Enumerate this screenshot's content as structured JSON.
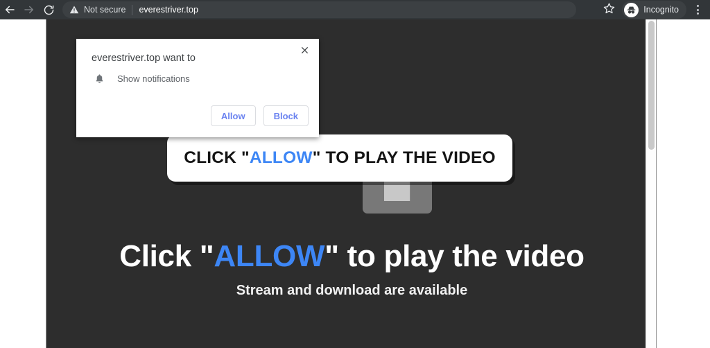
{
  "browser": {
    "nav": {
      "back_icon": "arrow-left-icon",
      "forward_icon": "arrow-right-icon",
      "reload_icon": "reload-icon"
    },
    "omnibox": {
      "security_icon": "warning-triangle-icon",
      "security_label": "Not secure",
      "url": "everestriver.top"
    },
    "bookmark_icon": "star-icon",
    "profile": {
      "icon": "incognito-icon",
      "label": "Incognito"
    },
    "menu_icon": "kebab-menu-icon"
  },
  "permission_dialog": {
    "close_icon": "close-icon",
    "title": "everestriver.top want to",
    "permission_icon": "bell-icon",
    "permission_label": "Show notifications",
    "allow_label": "Allow",
    "block_label": "Block"
  },
  "callout": {
    "text_before": "CLICK \"",
    "highlight": "ALLOW",
    "text_after": "\" TO PLAY THE VIDEO"
  },
  "page": {
    "plugin_icon": "puzzle-piece-icon",
    "headline_before": "Click \"",
    "headline_highlight": "ALLOW",
    "headline_after": "\" to play the video",
    "subheadline": "Stream and download are available",
    "colors": {
      "background": "#2d2d2d",
      "accent_blue": "#3d86f5",
      "text": "#ffffff"
    }
  }
}
